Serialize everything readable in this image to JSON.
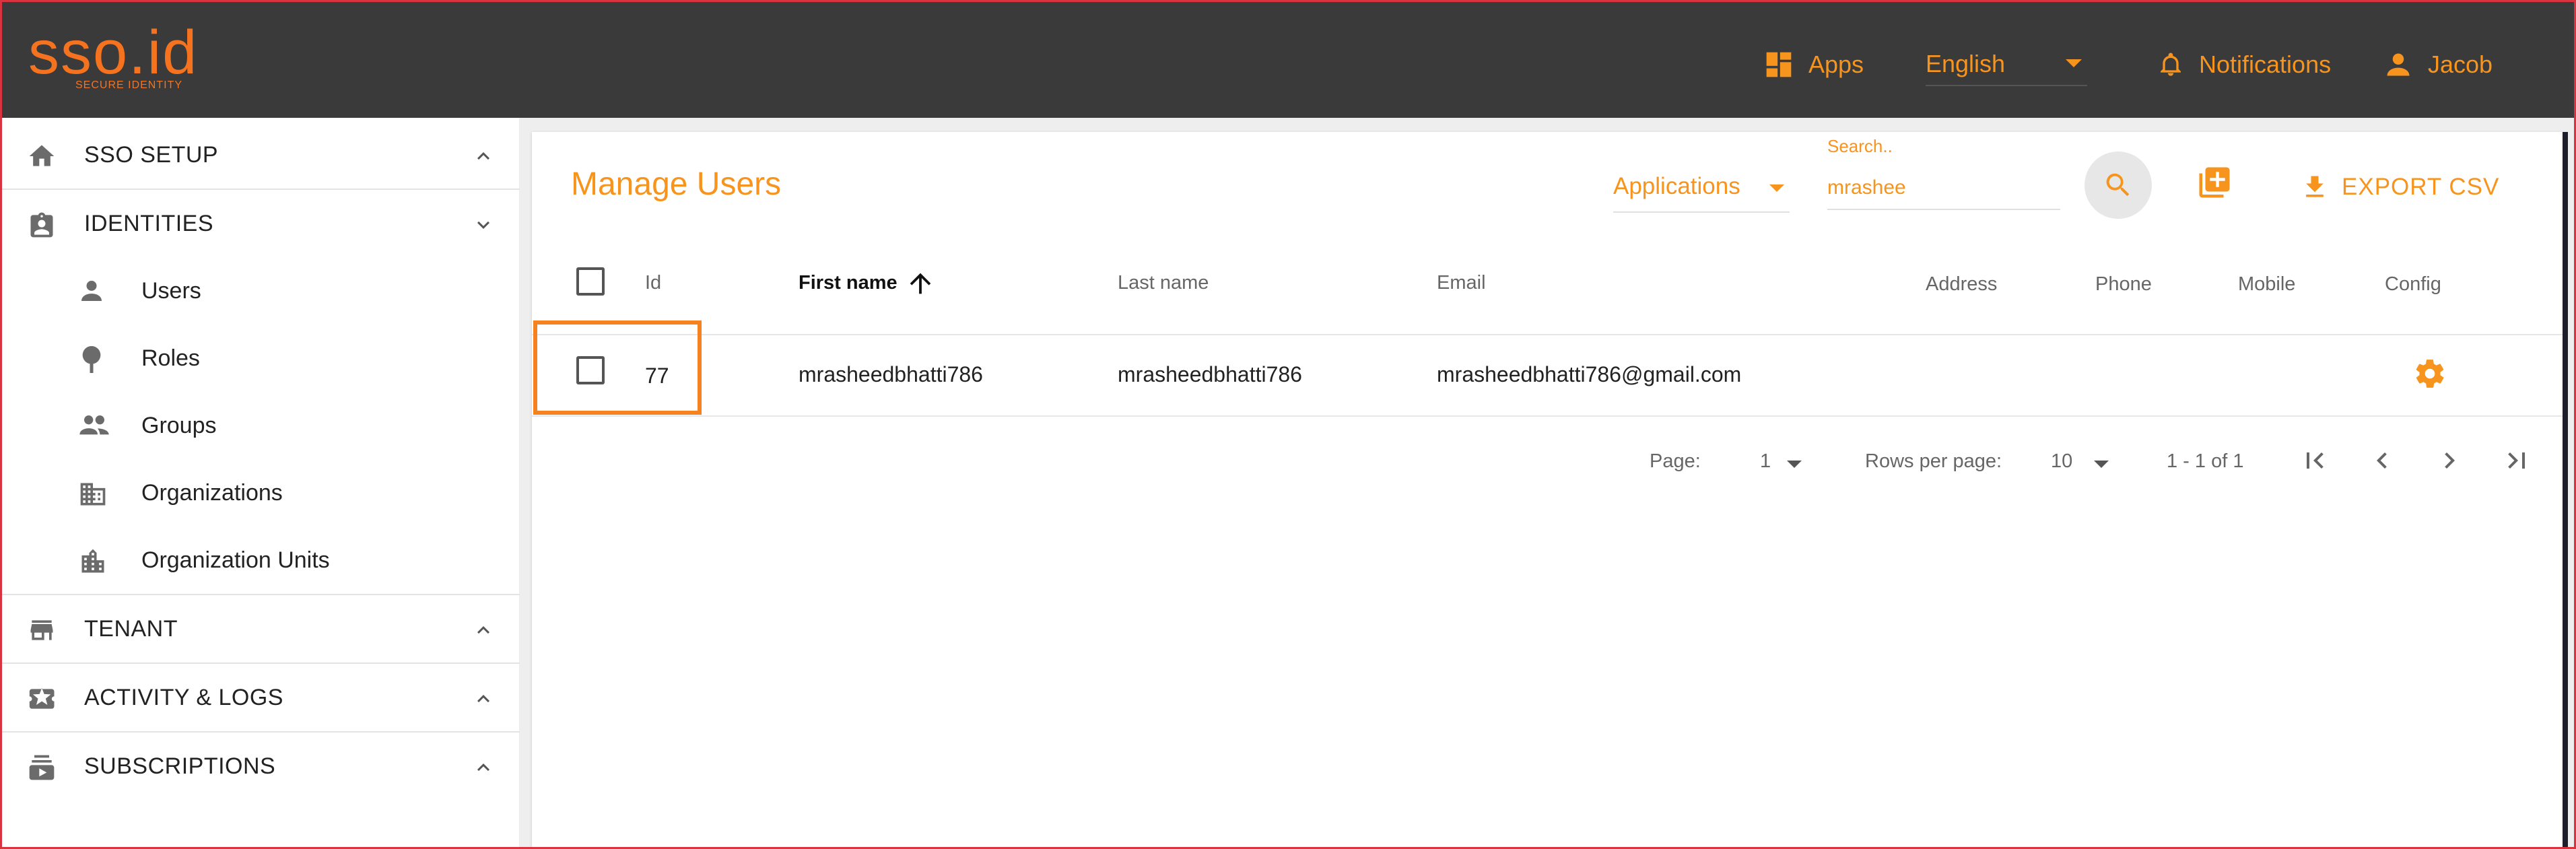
{
  "brand": {
    "name": "sso.id",
    "tagline": "SECURE IDENTITY",
    "accent": "#f7941d",
    "topbar_bg": "#3a3a3a"
  },
  "topbar": {
    "apps_label": "Apps",
    "language": "English",
    "notifications_label": "Notifications",
    "user_label": "Jacob",
    "icons": [
      "apps-grid-icon",
      "chevron-down-icon",
      "bell-icon",
      "person-icon"
    ]
  },
  "sidebar": {
    "sections": [
      {
        "label": "SSO SETUP",
        "icon": "home-icon",
        "expanded": false
      },
      {
        "label": "IDENTITIES",
        "icon": "badge-icon",
        "expanded": true,
        "items": [
          {
            "label": "Users",
            "icon": "person-icon"
          },
          {
            "label": "Roles",
            "icon": "pin-icon"
          },
          {
            "label": "Groups",
            "icon": "people-icon"
          },
          {
            "label": "Organizations",
            "icon": "building-icon"
          },
          {
            "label": "Organization Units",
            "icon": "city-icon"
          }
        ]
      },
      {
        "label": "TENANT",
        "icon": "store-icon",
        "expanded": false
      },
      {
        "label": "ACTIVITY & LOGS",
        "icon": "ticket-icon",
        "expanded": false
      },
      {
        "label": "SUBSCRIPTIONS",
        "icon": "subscriptions-icon",
        "expanded": false
      }
    ]
  },
  "main": {
    "title": "Manage Users",
    "applications_select": "Applications",
    "search": {
      "label": "Search..",
      "value": "mrashee"
    },
    "export_label": "EXPORT CSV",
    "table": {
      "columns": [
        "Id",
        "First name",
        "Last name",
        "Email",
        "Address",
        "Phone",
        "Mobile",
        "Config"
      ],
      "sorted_column": "First name",
      "rows": [
        {
          "id": "77",
          "first_name": "mrasheedbhatti786",
          "last_name": "mrasheedbhatti786",
          "email": "mrasheedbhatti786@gmail.com",
          "address": "",
          "phone": "",
          "mobile": ""
        }
      ]
    },
    "pagination": {
      "page_label": "Page:",
      "page_value": "1",
      "rows_label": "Rows per page:",
      "rows_value": "10",
      "range": "1 - 1 of 1"
    }
  }
}
